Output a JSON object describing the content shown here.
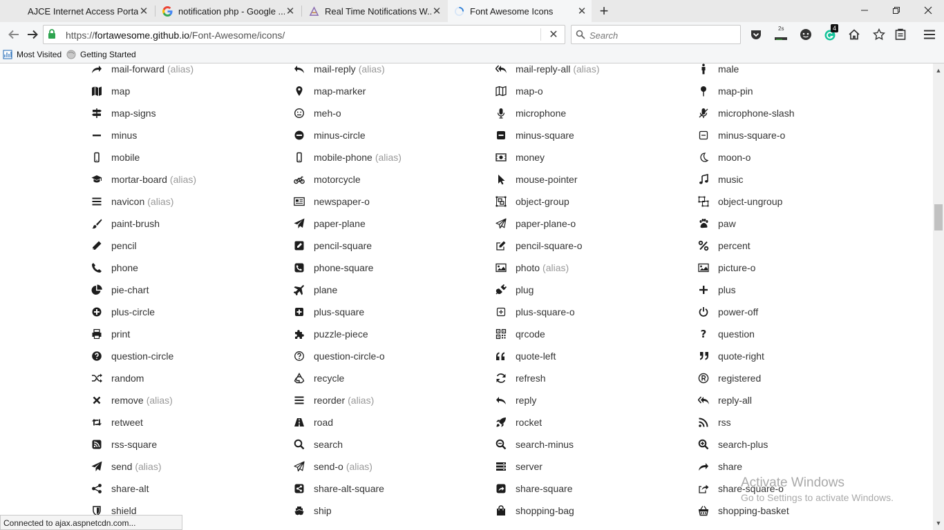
{
  "browser": {
    "tabs": [
      {
        "title": "AJCE Internet Access Portal",
        "active": false,
        "favicon": "blank-page-icon"
      },
      {
        "title": "notification php - Google ...",
        "active": false,
        "favicon": "google-icon"
      },
      {
        "title": "Real Time Notifications W...",
        "active": false,
        "favicon": "site-icon"
      },
      {
        "title": "Font Awesome Icons",
        "active": true,
        "favicon": "loading-spinner-icon"
      }
    ],
    "url_prefix": "https://",
    "url_domain": "fortawesome.github.io",
    "url_path": "/Font-Awesome/icons/",
    "search_placeholder": "Search",
    "downloads_label": "2s",
    "extension_badge": "4",
    "bookmarks": [
      "Most Visited",
      "Getting Started"
    ],
    "status_text": "Connected to ajax.aspnetcdn.com...",
    "watermark_title": "Activate Windows",
    "watermark_sub": "Go to Settings to activate Windows."
  },
  "alias_label": "(alias)",
  "icon_grid": [
    [
      {
        "name": "mail-forward",
        "alias": true,
        "icon": "fwd"
      },
      {
        "name": "map",
        "alias": false,
        "icon": "map"
      },
      {
        "name": "map-signs",
        "alias": false,
        "icon": "signs"
      },
      {
        "name": "minus",
        "alias": false,
        "icon": "minus"
      },
      {
        "name": "mobile",
        "alias": false,
        "icon": "mobile"
      },
      {
        "name": "mortar-board",
        "alias": true,
        "icon": "grad"
      },
      {
        "name": "navicon",
        "alias": true,
        "icon": "bars"
      },
      {
        "name": "paint-brush",
        "alias": false,
        "icon": "brush"
      },
      {
        "name": "pencil",
        "alias": false,
        "icon": "pencil"
      },
      {
        "name": "phone",
        "alias": false,
        "icon": "phone"
      },
      {
        "name": "pie-chart",
        "alias": false,
        "icon": "pie"
      },
      {
        "name": "plus-circle",
        "alias": false,
        "icon": "plus-circle"
      },
      {
        "name": "print",
        "alias": false,
        "icon": "print"
      },
      {
        "name": "question-circle",
        "alias": false,
        "icon": "q-circle"
      },
      {
        "name": "random",
        "alias": false,
        "icon": "random"
      },
      {
        "name": "remove",
        "alias": true,
        "icon": "times"
      },
      {
        "name": "retweet",
        "alias": false,
        "icon": "retweet"
      },
      {
        "name": "rss-square",
        "alias": false,
        "icon": "rss-sq"
      },
      {
        "name": "send",
        "alias": true,
        "icon": "plane-solid"
      },
      {
        "name": "share-alt",
        "alias": false,
        "icon": "share-alt"
      },
      {
        "name": "shield",
        "alias": false,
        "icon": "shield"
      }
    ],
    [
      {
        "name": "mail-reply",
        "alias": true,
        "icon": "reply"
      },
      {
        "name": "map-marker",
        "alias": false,
        "icon": "marker"
      },
      {
        "name": "meh-o",
        "alias": false,
        "icon": "meh"
      },
      {
        "name": "minus-circle",
        "alias": false,
        "icon": "minus-circle"
      },
      {
        "name": "mobile-phone",
        "alias": true,
        "icon": "mobile"
      },
      {
        "name": "motorcycle",
        "alias": false,
        "icon": "moto"
      },
      {
        "name": "newspaper-o",
        "alias": false,
        "icon": "news"
      },
      {
        "name": "paper-plane",
        "alias": false,
        "icon": "plane-solid"
      },
      {
        "name": "pencil-square",
        "alias": false,
        "icon": "pencil-sq"
      },
      {
        "name": "phone-square",
        "alias": false,
        "icon": "phone-sq"
      },
      {
        "name": "plane",
        "alias": false,
        "icon": "airplane"
      },
      {
        "name": "plus-square",
        "alias": false,
        "icon": "plus-sq"
      },
      {
        "name": "puzzle-piece",
        "alias": false,
        "icon": "puzzle"
      },
      {
        "name": "question-circle-o",
        "alias": false,
        "icon": "q-circle-o"
      },
      {
        "name": "recycle",
        "alias": false,
        "icon": "recycle"
      },
      {
        "name": "reorder",
        "alias": true,
        "icon": "bars"
      },
      {
        "name": "road",
        "alias": false,
        "icon": "road"
      },
      {
        "name": "search",
        "alias": false,
        "icon": "search"
      },
      {
        "name": "send-o",
        "alias": true,
        "icon": "plane-o"
      },
      {
        "name": "share-alt-square",
        "alias": false,
        "icon": "share-alt-sq"
      },
      {
        "name": "ship",
        "alias": false,
        "icon": "ship"
      }
    ],
    [
      {
        "name": "mail-reply-all",
        "alias": true,
        "icon": "reply-all"
      },
      {
        "name": "map-o",
        "alias": false,
        "icon": "map-o"
      },
      {
        "name": "microphone",
        "alias": false,
        "icon": "mic"
      },
      {
        "name": "minus-square",
        "alias": false,
        "icon": "minus-sq"
      },
      {
        "name": "money",
        "alias": false,
        "icon": "money"
      },
      {
        "name": "mouse-pointer",
        "alias": false,
        "icon": "pointer"
      },
      {
        "name": "object-group",
        "alias": false,
        "icon": "obj-group"
      },
      {
        "name": "paper-plane-o",
        "alias": false,
        "icon": "plane-o"
      },
      {
        "name": "pencil-square-o",
        "alias": false,
        "icon": "pencil-sq-o"
      },
      {
        "name": "photo",
        "alias": true,
        "icon": "photo"
      },
      {
        "name": "plug",
        "alias": false,
        "icon": "plug"
      },
      {
        "name": "plus-square-o",
        "alias": false,
        "icon": "plus-sq-o"
      },
      {
        "name": "qrcode",
        "alias": false,
        "icon": "qr"
      },
      {
        "name": "quote-left",
        "alias": false,
        "icon": "quote-l"
      },
      {
        "name": "refresh",
        "alias": false,
        "icon": "refresh"
      },
      {
        "name": "reply",
        "alias": false,
        "icon": "reply"
      },
      {
        "name": "rocket",
        "alias": false,
        "icon": "rocket"
      },
      {
        "name": "search-minus",
        "alias": false,
        "icon": "search-minus"
      },
      {
        "name": "server",
        "alias": false,
        "icon": "server"
      },
      {
        "name": "share-square",
        "alias": false,
        "icon": "share-sq"
      },
      {
        "name": "shopping-bag",
        "alias": false,
        "icon": "bag"
      }
    ],
    [
      {
        "name": "male",
        "alias": false,
        "icon": "male"
      },
      {
        "name": "map-pin",
        "alias": false,
        "icon": "pin"
      },
      {
        "name": "microphone-slash",
        "alias": false,
        "icon": "mic-slash"
      },
      {
        "name": "minus-square-o",
        "alias": false,
        "icon": "minus-sq-o"
      },
      {
        "name": "moon-o",
        "alias": false,
        "icon": "moon"
      },
      {
        "name": "music",
        "alias": false,
        "icon": "music"
      },
      {
        "name": "object-ungroup",
        "alias": false,
        "icon": "obj-ungroup"
      },
      {
        "name": "paw",
        "alias": false,
        "icon": "paw"
      },
      {
        "name": "percent",
        "alias": false,
        "icon": "percent"
      },
      {
        "name": "picture-o",
        "alias": false,
        "icon": "photo"
      },
      {
        "name": "plus",
        "alias": false,
        "icon": "plus"
      },
      {
        "name": "power-off",
        "alias": false,
        "icon": "power"
      },
      {
        "name": "question",
        "alias": false,
        "icon": "question"
      },
      {
        "name": "quote-right",
        "alias": false,
        "icon": "quote-r"
      },
      {
        "name": "registered",
        "alias": false,
        "icon": "registered"
      },
      {
        "name": "reply-all",
        "alias": false,
        "icon": "reply-all"
      },
      {
        "name": "rss",
        "alias": false,
        "icon": "rss"
      },
      {
        "name": "search-plus",
        "alias": false,
        "icon": "search-plus"
      },
      {
        "name": "share",
        "alias": false,
        "icon": "fwd"
      },
      {
        "name": "share-square-o",
        "alias": false,
        "icon": "share-sq-o"
      },
      {
        "name": "shopping-basket",
        "alias": false,
        "icon": "basket"
      }
    ]
  ]
}
